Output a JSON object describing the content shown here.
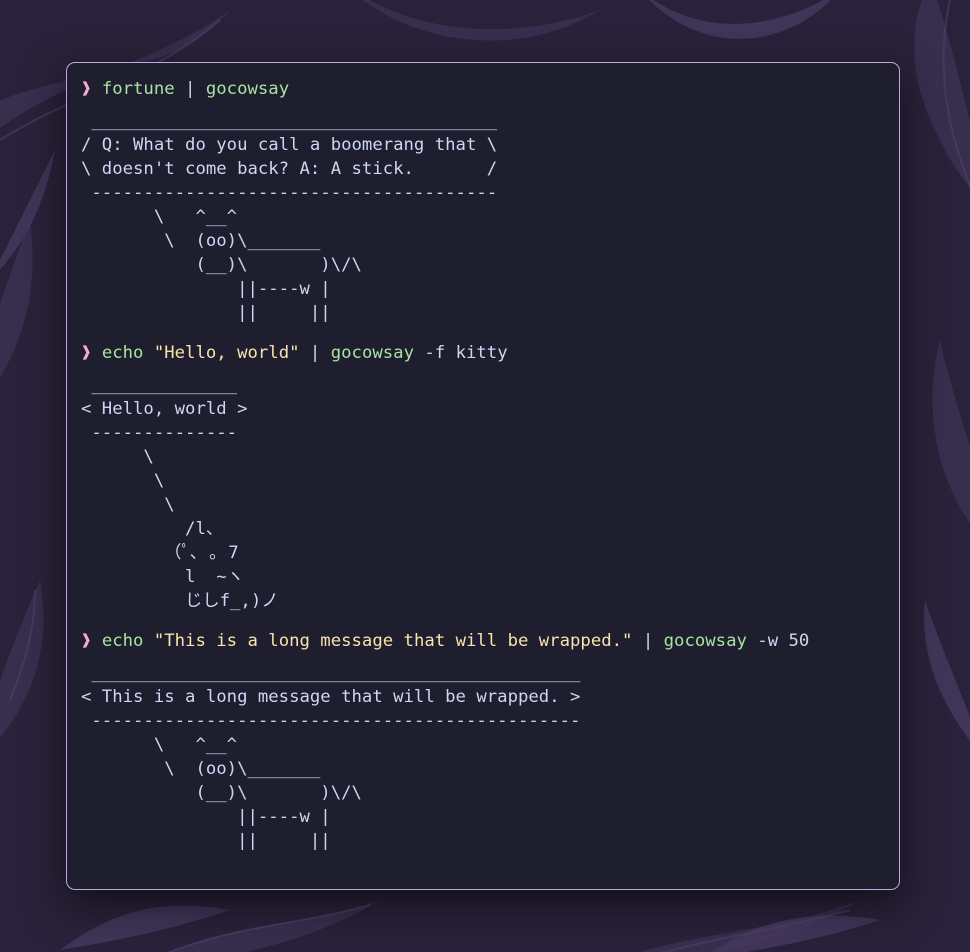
{
  "colors": {
    "terminal_bg": "#1e1e2e",
    "terminal_border": "#c3a6e0",
    "prompt": "#f5a9d0",
    "command": "#a6e3a1",
    "string": "#f9e2af",
    "text": "#cdd6f4",
    "wallpaper": "#2a2438"
  },
  "prompt_symbol": "❱",
  "blocks": [
    {
      "command": {
        "parts": [
          {
            "type": "cmd",
            "text": "fortune"
          },
          {
            "type": "pipe",
            "text": " | "
          },
          {
            "type": "cmd",
            "text": "gocowsay"
          }
        ]
      },
      "output": [
        " _______________________________________",
        "/ Q: What do you call a boomerang that \\",
        "\\ doesn't come back? A: A stick.       /",
        " ---------------------------------------",
        "       \\   ^__^",
        "        \\  (oo)\\_______",
        "           (__)\\       )\\/\\",
        "               ||----w |",
        "               ||     ||"
      ]
    },
    {
      "command": {
        "parts": [
          {
            "type": "cmd",
            "text": "echo"
          },
          {
            "type": "arg",
            "text": " "
          },
          {
            "type": "str",
            "text": "\"Hello, world\""
          },
          {
            "type": "pipe",
            "text": " | "
          },
          {
            "type": "cmd",
            "text": "gocowsay"
          },
          {
            "type": "arg",
            "text": " -f kitty"
          }
        ]
      },
      "output": [
        " ______________",
        "< Hello, world >",
        " --------------",
        "      \\",
        "       \\",
        "        \\",
        "          /l、",
        "        （ﾟ､ ｡ 7",
        "          l  ~ヽ",
        "          じしf_,)ノ"
      ]
    },
    {
      "command": {
        "parts": [
          {
            "type": "cmd",
            "text": "echo"
          },
          {
            "type": "arg",
            "text": " "
          },
          {
            "type": "str",
            "text": "\"This is a long message that will be wrapped.\""
          },
          {
            "type": "pipe",
            "text": " | "
          },
          {
            "type": "cmd",
            "text": "gocowsay"
          },
          {
            "type": "arg",
            "text": " -w 50"
          }
        ]
      },
      "output": [
        " _______________________________________________",
        "< This is a long message that will be wrapped. >",
        " -----------------------------------------------",
        "       \\   ^__^",
        "        \\  (oo)\\_______",
        "           (__)\\       )\\/\\",
        "               ||----w |",
        "               ||     ||"
      ]
    }
  ]
}
